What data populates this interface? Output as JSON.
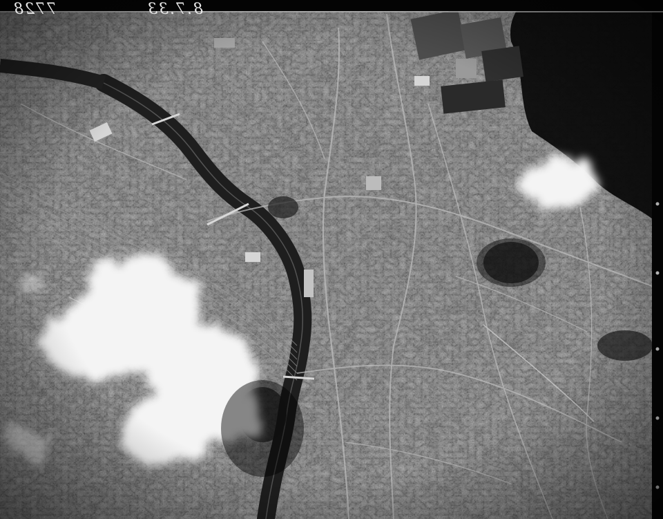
{
  "photo": {
    "subject": "aerial-city-river",
    "palette": {
      "base": "#3a3a3a",
      "dark": "#111111",
      "river": "#1e1e1e",
      "lake": "#0b0b0b",
      "field": "#4c4c4c",
      "street": "#bdbdbd",
      "cloud": "#f4f4f4"
    }
  },
  "annotations": {
    "plate_number": "7728",
    "plate_date": "8.7.33"
  }
}
